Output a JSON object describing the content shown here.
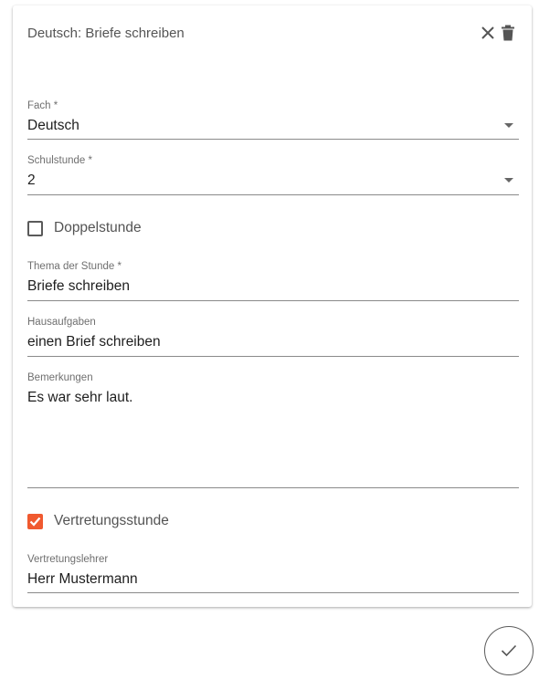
{
  "card": {
    "title": "Deutsch: Briefe schreiben",
    "close_icon": "close-icon",
    "delete_icon": "trash-icon"
  },
  "form": {
    "fach": {
      "label": "Fach *",
      "value": "Deutsch"
    },
    "schulstunde": {
      "label": "Schulstunde *",
      "value": "2"
    },
    "doppelstunde": {
      "label": "Doppelstunde",
      "checked": false
    },
    "thema": {
      "label": "Thema der Stunde *",
      "value": "Briefe schreiben"
    },
    "hausaufgaben": {
      "label": "Hausaufgaben",
      "value": "einen Brief schreiben"
    },
    "bemerkungen": {
      "label": "Bemerkungen",
      "value": "Es war sehr laut."
    },
    "vertretungsstunde": {
      "label": "Vertretungsstunde",
      "checked": true
    },
    "vertretungslehrer": {
      "label": "Vertretungslehrer",
      "value": "Herr Mustermann"
    }
  },
  "confirm_icon": "check-icon",
  "colors": {
    "accent": "#f0592f",
    "underline": "#8a8a8a"
  }
}
